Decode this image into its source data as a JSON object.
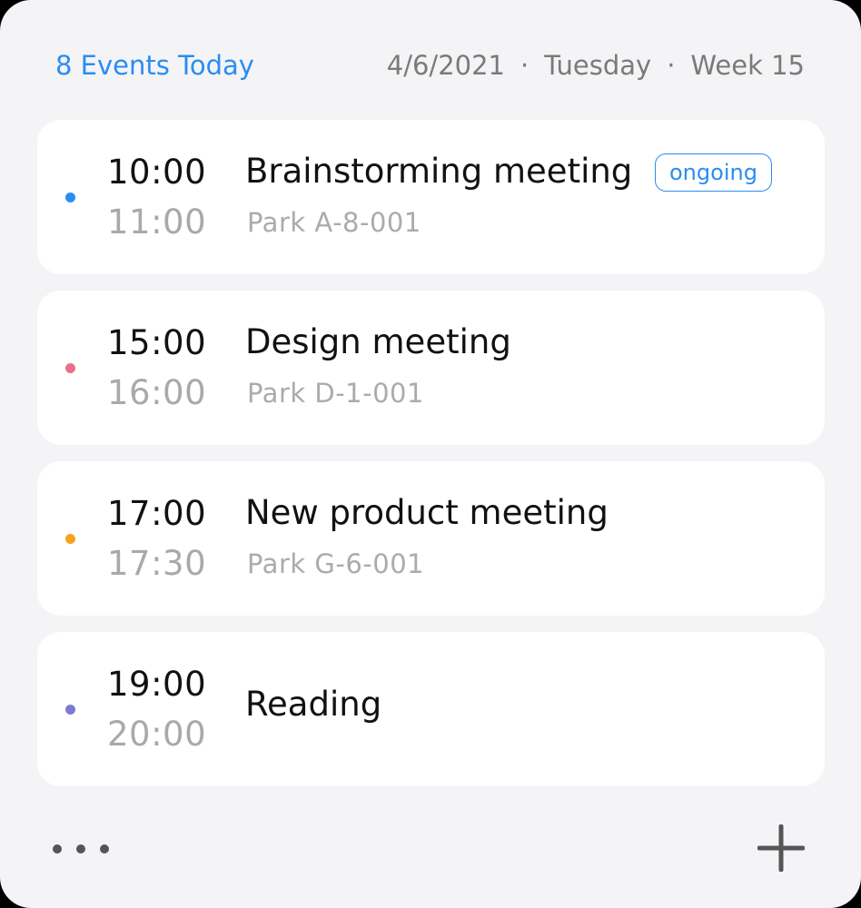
{
  "header": {
    "events_count": "8 Events Today",
    "date": "4/6/2021",
    "separator": "·",
    "weekday": "Tuesday",
    "week": "Week 15"
  },
  "colors": {
    "accent": "#2a8df2",
    "event_dots": [
      "#2a8df2",
      "#e8708c",
      "#f5a21c",
      "#7b7bd0"
    ]
  },
  "events": [
    {
      "start": "10:00",
      "end": "11:00",
      "title": "Brainstorming meeting",
      "location": "Park A-8-001",
      "badge": "ongoing"
    },
    {
      "start": "15:00",
      "end": "16:00",
      "title": "Design meeting",
      "location": "Park D-1-001"
    },
    {
      "start": "17:00",
      "end": "17:30",
      "title": "New product meeting",
      "location": "Park G-6-001"
    },
    {
      "start": "19:00",
      "end": "20:00",
      "title": "Reading"
    }
  ],
  "footer": {
    "more_icon": "more-horizontal-icon",
    "add_icon": "plus-icon"
  }
}
